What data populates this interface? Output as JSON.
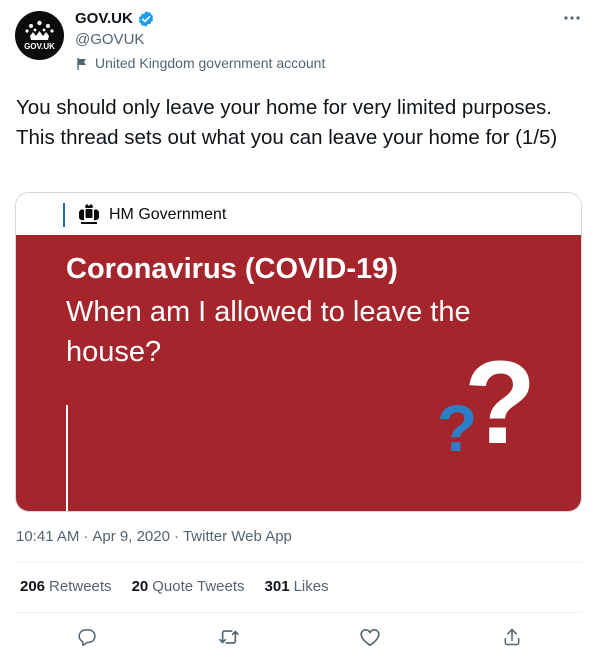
{
  "header": {
    "avatar_text": "GOV.UK",
    "display_name": "GOV.UK",
    "handle": "@GOVUK",
    "label": "United Kingdom government account",
    "verified_icon": "verified-badge-icon",
    "more_icon": "more-icon"
  },
  "tweet": {
    "text": "You should only leave your home for very limited purposes. This thread sets out what you can leave your home for (1/5)"
  },
  "media": {
    "org": "HM Government",
    "line1": "Coronavirus (COVID-19)",
    "line2": "When am I allowed to leave the house?",
    "q_big": "?",
    "q_small": "?",
    "colors": {
      "red": "#a4262c",
      "blue": "#2c7fc7",
      "govbar": "#1d70b8"
    }
  },
  "meta": {
    "time": "10:41 AM",
    "sep1": "·",
    "date": "Apr 9, 2020",
    "sep2": "·",
    "source": "Twitter Web App"
  },
  "stats": {
    "retweets_count": "206",
    "retweets_label": "Retweets",
    "quotes_count": "20",
    "quotes_label": "Quote Tweets",
    "likes_count": "301",
    "likes_label": "Likes"
  },
  "actions": [
    "reply-icon",
    "retweet-icon",
    "like-icon",
    "share-icon"
  ],
  "colors": {
    "accent": "#1d9bf0",
    "muted": "#536471",
    "text": "#0f1419"
  }
}
